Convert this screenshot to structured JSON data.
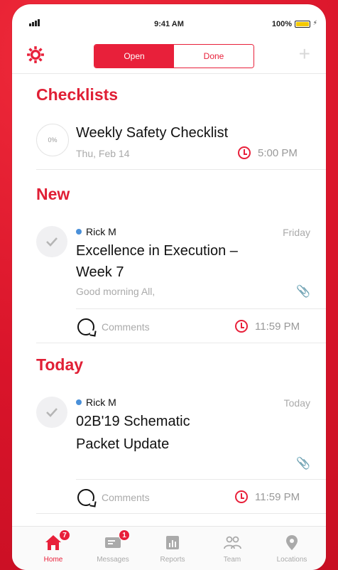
{
  "status_bar": {
    "time": "9:41 AM",
    "battery_percent": "100%"
  },
  "header": {
    "segments": [
      {
        "label": "Open",
        "active": true
      },
      {
        "label": "Done",
        "active": false
      }
    ],
    "add_label": "+"
  },
  "sections": {
    "checklists": {
      "title": "Checklists",
      "item": {
        "progress": "0%",
        "title": "Weekly Safety Checklist",
        "date": "Thu, Feb 14",
        "due_time": "5:00 PM"
      }
    },
    "new": {
      "title": "New",
      "item": {
        "author": "Rick M",
        "day": "Friday",
        "title_line1": "Excellence in Execution –",
        "title_line2": "Week 7",
        "preview": "Good morning All,",
        "comments_label": "Comments",
        "due_time": "11:59 PM"
      }
    },
    "today": {
      "title": "Today",
      "item": {
        "author": "Rick M",
        "day": "Today",
        "title_line1": "02B'19 Schematic",
        "title_line2": "Packet Update",
        "comments_label": "Comments",
        "due_time": "11:59 PM"
      }
    }
  },
  "tabbar": {
    "tabs": [
      {
        "label": "Home",
        "badge": "7",
        "active": true,
        "icon": "home-icon"
      },
      {
        "label": "Messages",
        "badge": "1",
        "active": false,
        "icon": "messages-icon"
      },
      {
        "label": "Reports",
        "badge": "",
        "active": false,
        "icon": "reports-icon"
      },
      {
        "label": "Team",
        "badge": "",
        "active": false,
        "icon": "team-icon"
      },
      {
        "label": "Locations",
        "badge": "",
        "active": false,
        "icon": "location-pin-icon"
      }
    ]
  },
  "colors": {
    "accent": "#e8203a",
    "background": "#e31b2f"
  }
}
